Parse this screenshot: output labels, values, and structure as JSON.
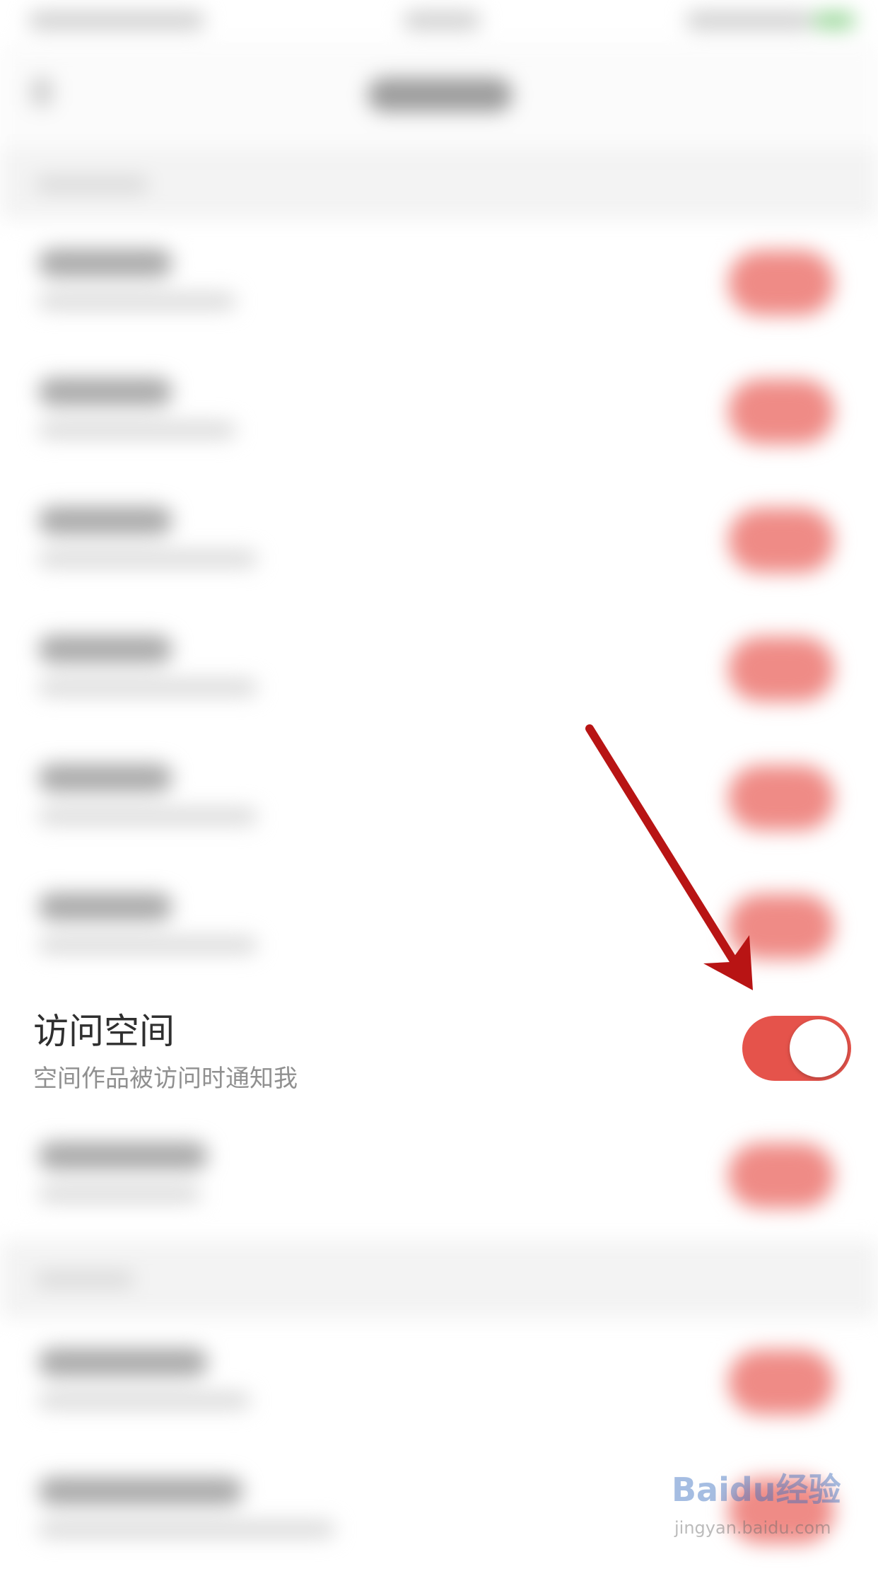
{
  "settings": {
    "highlighted_row": {
      "title": "访问空间",
      "subtitle": "空间作品被访问时通知我",
      "toggle_on": true
    }
  },
  "colors": {
    "toggle_on": "#e5534b",
    "annotation_arrow": "#b81414",
    "blurred_toggle": "#ef8b86"
  },
  "watermark": {
    "logo": "Baidu经验",
    "url": "jingyan.baidu.com"
  }
}
